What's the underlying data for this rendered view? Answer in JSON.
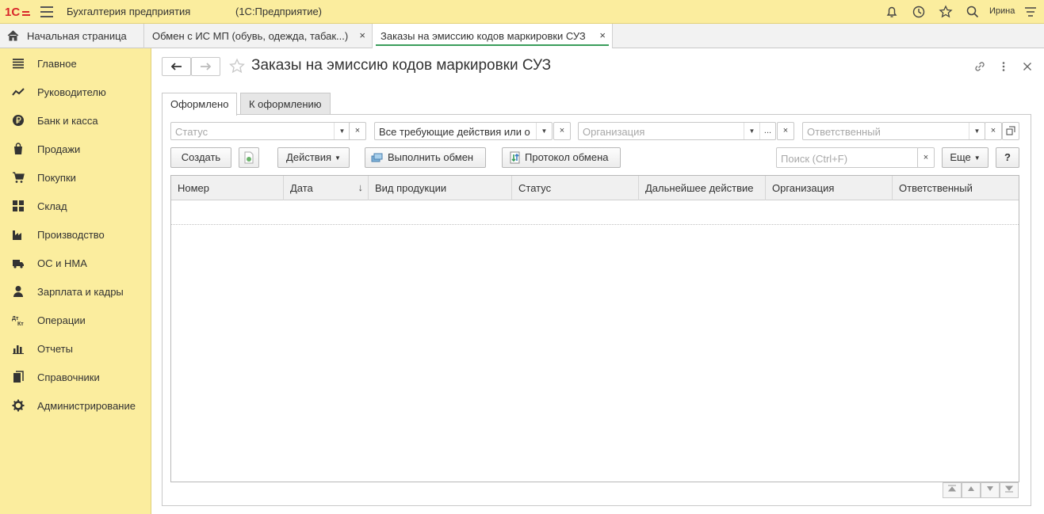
{
  "app": {
    "logo_text": "1С",
    "title": "Бухгалтерия предприятия",
    "subtitle": "(1С:Предприятие)",
    "user": "Ирина"
  },
  "open_tabs": [
    {
      "label": "Начальная страница"
    },
    {
      "label": "Обмен с ИС МП (обувь, одежда, табак...)",
      "close": "×"
    },
    {
      "label": "Заказы на эмиссию кодов маркировки СУЗ",
      "close": "×"
    }
  ],
  "sidebar": {
    "items": [
      {
        "label": "Главное",
        "icon": "menu-lines-icon"
      },
      {
        "label": "Руководителю",
        "icon": "trend-chart-icon"
      },
      {
        "label": "Банк и касса",
        "icon": "ruble-coin-icon"
      },
      {
        "label": "Продажи",
        "icon": "shopping-bag-icon"
      },
      {
        "label": "Покупки",
        "icon": "shopping-cart-icon"
      },
      {
        "label": "Склад",
        "icon": "warehouse-grid-icon"
      },
      {
        "label": "Производство",
        "icon": "factory-icon"
      },
      {
        "label": "ОС и НМА",
        "icon": "truck-icon"
      },
      {
        "label": "Зарплата и кадры",
        "icon": "person-icon"
      },
      {
        "label": "Операции",
        "icon": "dt-kt-icon"
      },
      {
        "label": "Отчеты",
        "icon": "bar-chart-icon"
      },
      {
        "label": "Справочники",
        "icon": "books-icon"
      },
      {
        "label": "Администрирование",
        "icon": "gear-icon"
      }
    ]
  },
  "page": {
    "title": "Заказы на эмиссию кодов маркировки СУЗ",
    "form_tabs": [
      "Оформлено",
      "К оформлению"
    ]
  },
  "filters": {
    "status_placeholder": "Статус",
    "action_value": "Все требующие действия или о",
    "org_placeholder": "Организация",
    "resp_placeholder": "Ответственный",
    "clear": "×",
    "dots": "...",
    "dropdown": "▼"
  },
  "toolbar": {
    "create": "Создать",
    "actions": "Действия",
    "exchange": "Выполнить обмен",
    "protocol": "Протокол обмена",
    "search_placeholder": "Поиск (Ctrl+F)",
    "more": "Еще",
    "help": "?"
  },
  "table": {
    "columns": [
      "Номер",
      "Дата",
      "Вид продукции",
      "Статус",
      "Дальнейшее действие",
      "Организация",
      "Ответственный"
    ],
    "sort_arrow": "↓",
    "rows": []
  },
  "colors": {
    "sidebar_bg": "#fbed9e",
    "accent_green": "#3a9d5b",
    "logo_red": "#d8262a"
  }
}
